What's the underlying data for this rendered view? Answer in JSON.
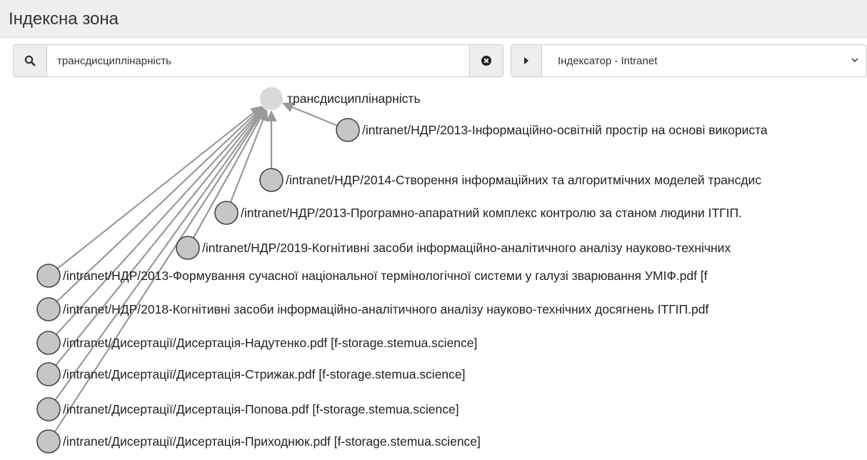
{
  "header": {
    "title": "Індексна зона"
  },
  "search": {
    "value": "трансдисциплінарність",
    "icon": "search-icon",
    "clear_icon": "clear-circle-icon"
  },
  "indexer": {
    "play_icon": "caret-right-icon",
    "selected": "Індексатор - Intranet",
    "chevron_icon": "chevron-down-icon"
  },
  "graph": {
    "root": {
      "label": "трансдисциплінарність"
    },
    "nodes": [
      {
        "label": "/intranet/НДР/2013-Інформаційно-освітній простір на основі використа"
      },
      {
        "label": "/intranet/НДР/2014-Створення інформаційних та алгоритмічних моделей трансдис"
      },
      {
        "label": "/intranet/НДР/2013-Програмно-апаратний комплекс контролю за станом людини ІТГІП."
      },
      {
        "label": "/intranet/НДР/2019-Когнітивні засоби інформаційно-аналітичного аналізу науково-технічних"
      },
      {
        "label": "/intranet/НДР/2013-Формування сучасної національної термінологічної системи у галузі зварювання УМІФ.pdf [f"
      },
      {
        "label": "/intranet/НДР/2018-Когнітивні засоби інформаційно-аналітичного аналізу науково-технічних досягнень ІТГІП.pdf"
      },
      {
        "label": "/intranet/Дисертації/Дисертація-Надутенко.pdf [f-storage.stemua.science]"
      },
      {
        "label": "/intranet/Дисертації/Дисертація-Стрижак.pdf [f-storage.stemua.science]"
      },
      {
        "label": "/intranet/Дисертації/Дисертація-Попова.pdf [f-storage.stemua.science]"
      },
      {
        "label": "/intranet/Дисертації/Дисертація-Приходнюк.pdf [f-storage.stemua.science]"
      }
    ]
  },
  "colors": {
    "node_fill": "#c6c6c6",
    "node_stroke": "#444444",
    "root_fill": "#d9d9d9",
    "edge": "#999999",
    "header_bg": "#efefef"
  }
}
